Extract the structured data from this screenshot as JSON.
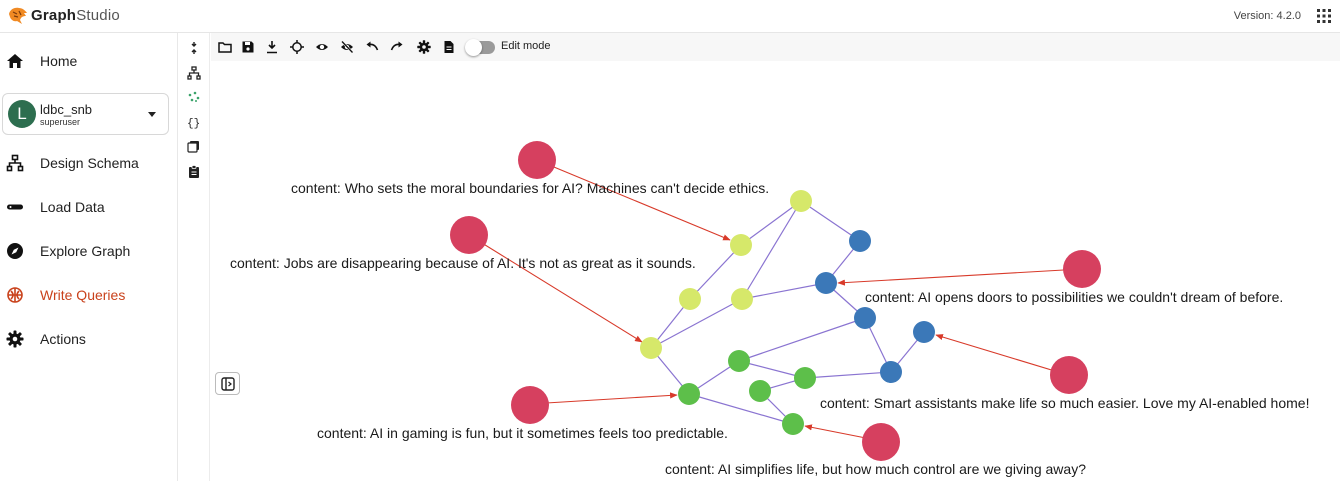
{
  "app": {
    "brand_main": "Graph",
    "brand_sub": "Studio",
    "version": "Version: 4.2.0"
  },
  "sidebar": {
    "items": [
      {
        "label": "Home",
        "icon": "home-icon"
      },
      {
        "label": "Design Schema",
        "icon": "schema-icon"
      },
      {
        "label": "Load Data",
        "icon": "load-data-icon"
      },
      {
        "label": "Explore Graph",
        "icon": "compass-icon"
      },
      {
        "label": "Write Queries",
        "icon": "queries-icon",
        "active": true
      },
      {
        "label": "Actions",
        "icon": "gear-icon"
      }
    ],
    "graph": {
      "initial": "L",
      "name": "ldbc_snb",
      "role": "superuser"
    }
  },
  "toolbar": {
    "icons": [
      "folder-icon",
      "save-icon",
      "download-icon",
      "locate-icon",
      "show-icon",
      "hide-icon",
      "undo-icon",
      "redo-icon",
      "settings-icon",
      "document-icon"
    ],
    "edit_mode_label": "Edit mode",
    "edit_mode_on": false
  },
  "vertical_tools": [
    "collapse-icon",
    "schema-icon",
    "graph-icon",
    "json-icon",
    "table-icon",
    "log-icon"
  ],
  "colors": {
    "accent": "#c9421c",
    "post": "#d6405f",
    "yellow": "#d6e86a",
    "blue": "#3b78b8",
    "green": "#5dbf4a",
    "edge_purple": "#8a74d1",
    "edge_red": "#d83a2a"
  },
  "graph": {
    "post_labels": [
      "content: Who sets the moral boundaries for AI? Machines can't decide ethics.",
      "content: Jobs are disappearing because of AI. It's not as great as it sounds.",
      "content: AI opens doors to possibilities we couldn't dream of before.",
      "content: Smart assistants make life so much easier. Love my AI-enabled home!",
      "content: AI in gaming is fun, but it sometimes feels too predictable.",
      "content: AI simplifies life, but how much control are we giving away?"
    ]
  }
}
